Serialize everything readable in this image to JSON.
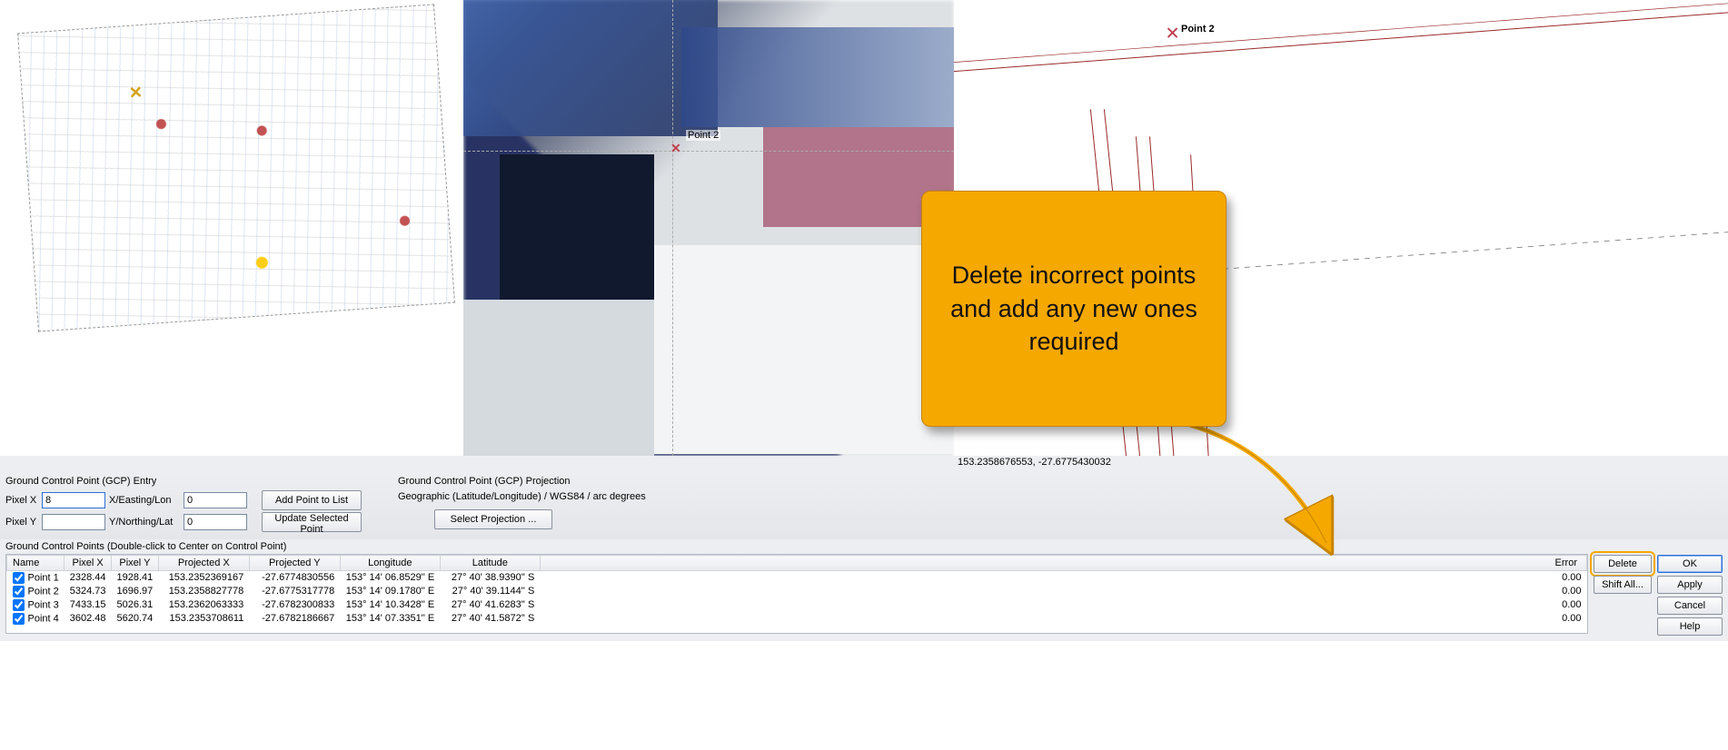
{
  "panels": {
    "mid": {
      "point_label": "Point 2"
    },
    "right": {
      "point_label": "Point 2",
      "coord_readout": "153.2358676553, -27.6775430032"
    }
  },
  "callout": {
    "text": "Delete incorrect points and add any new ones required"
  },
  "entry": {
    "title": "Ground Control Point (GCP) Entry",
    "pixel_x_label": "Pixel X",
    "pixel_y_label": "Pixel Y",
    "easting_label": "X/Easting/Lon",
    "northing_label": "Y/Northing/Lat",
    "pixel_x_value": "8",
    "pixel_y_value": "",
    "easting_value": "0",
    "northing_value": "0",
    "add_btn": "Add Point to List",
    "update_btn": "Update Selected Point"
  },
  "projection": {
    "title": "Ground Control Point (GCP) Projection",
    "desc": "Geographic (Latitude/Longitude) / WGS84 / arc degrees",
    "select_btn": "Select Projection ..."
  },
  "table": {
    "caption": "Ground Control Points (Double-click to Center on Control Point)",
    "cols": {
      "name": "Name",
      "px": "Pixel X",
      "py": "Pixel Y",
      "projx": "Projected X",
      "projy": "Projected Y",
      "lon": "Longitude",
      "lat": "Latitude",
      "err": "Error"
    },
    "rows": [
      {
        "name": "Point 1",
        "px": "2328.44",
        "py": "1928.41",
        "projx": "153.2352369167",
        "projy": "-27.6774830556",
        "lon": "153° 14' 06.8529'' E",
        "lat": "27° 40' 38.9390'' S",
        "err": "0.00"
      },
      {
        "name": "Point 2",
        "px": "5324.73",
        "py": "1696.97",
        "projx": "153.2358827778",
        "projy": "-27.6775317778",
        "lon": "153° 14' 09.1780'' E",
        "lat": "27° 40' 39.1144'' S",
        "err": "0.00"
      },
      {
        "name": "Point 3",
        "px": "7433.15",
        "py": "5026.31",
        "projx": "153.2362063333",
        "projy": "-27.6782300833",
        "lon": "153° 14' 10.3428'' E",
        "lat": "27° 40' 41.6283'' S",
        "err": "0.00"
      },
      {
        "name": "Point 4",
        "px": "3602.48",
        "py": "5620.74",
        "projx": "153.2353708611",
        "projy": "-27.6782186667",
        "lon": "153° 14' 07.3351'' E",
        "lat": "27° 40' 41.5872'' S",
        "err": "0.00"
      }
    ]
  },
  "buttons": {
    "delete": "Delete",
    "shift_all": "Shift All...",
    "ok": "OK",
    "apply": "Apply",
    "cancel": "Cancel",
    "help": "Help"
  }
}
